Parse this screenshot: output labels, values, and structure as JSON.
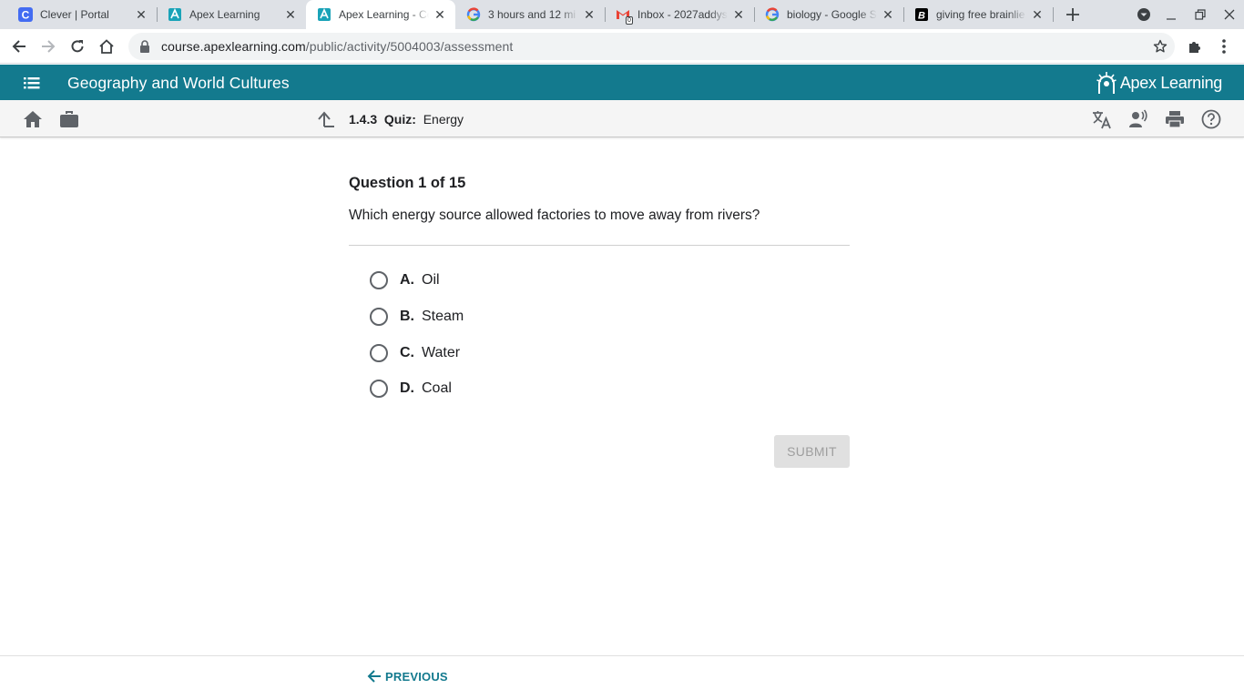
{
  "browser": {
    "tabs": [
      {
        "title": "Clever | Portal",
        "favicon": "clever-icon",
        "active": false
      },
      {
        "title": "Apex Learning",
        "favicon": "apex-icon",
        "active": false
      },
      {
        "title": "Apex Learning - Co",
        "favicon": "apex-icon",
        "active": true
      },
      {
        "title": "3 hours and 12 mi",
        "favicon": "google-icon",
        "active": false
      },
      {
        "title": "Inbox - 2027addys",
        "favicon": "gmail-icon",
        "active": false
      },
      {
        "title": "biology - Google S",
        "favicon": "google-icon",
        "active": false
      },
      {
        "title": "giving free brainlie",
        "favicon": "brainly-icon",
        "active": false
      }
    ],
    "gmail_badge": "0",
    "url_host": "course.apexlearning.com",
    "url_path": "/public/activity/5004003/assessment"
  },
  "header": {
    "course_title": "Geography and World Cultures",
    "logo_text": "Apex Learning",
    "brand_color": "#137a8e"
  },
  "subbar": {
    "activity_number": "1.4.3",
    "activity_type": "Quiz:",
    "activity_name": "Energy"
  },
  "question": {
    "heading": "Question 1 of 15",
    "prompt": "Which energy source allowed factories to move away from rivers?",
    "answers": [
      {
        "letter": "A.",
        "text": "Oil"
      },
      {
        "letter": "B.",
        "text": "Steam"
      },
      {
        "letter": "C.",
        "text": "Water"
      },
      {
        "letter": "D.",
        "text": "Coal"
      }
    ],
    "submit_label": "SUBMIT"
  },
  "footer": {
    "previous_label": "PREVIOUS"
  }
}
